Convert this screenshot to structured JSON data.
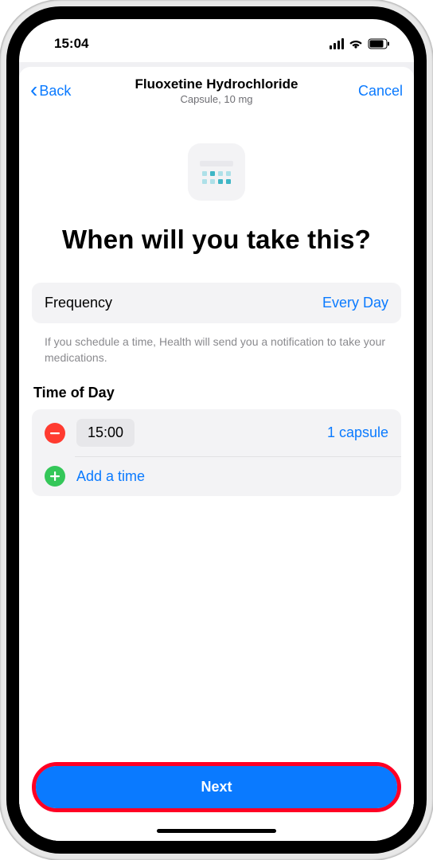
{
  "statusbar": {
    "time": "15:04"
  },
  "nav": {
    "back_label": "Back",
    "cancel_label": "Cancel",
    "title": "Fluoxetine Hydrochloride",
    "subtitle": "Capsule, 10 mg"
  },
  "headline": "When will you take this?",
  "frequency": {
    "label": "Frequency",
    "value": "Every Day"
  },
  "hint": "If you schedule a time, Health will send you a notification to take your medications.",
  "time_section": {
    "title": "Time of Day",
    "rows": [
      {
        "time": "15:00",
        "dose": "1 capsule"
      }
    ],
    "add_label": "Add a time"
  },
  "footer": {
    "next_label": "Next"
  },
  "colors": {
    "tint": "#0a7aff",
    "red": "#ff3b30",
    "green": "#34c759",
    "highlight": "#ff0024"
  }
}
